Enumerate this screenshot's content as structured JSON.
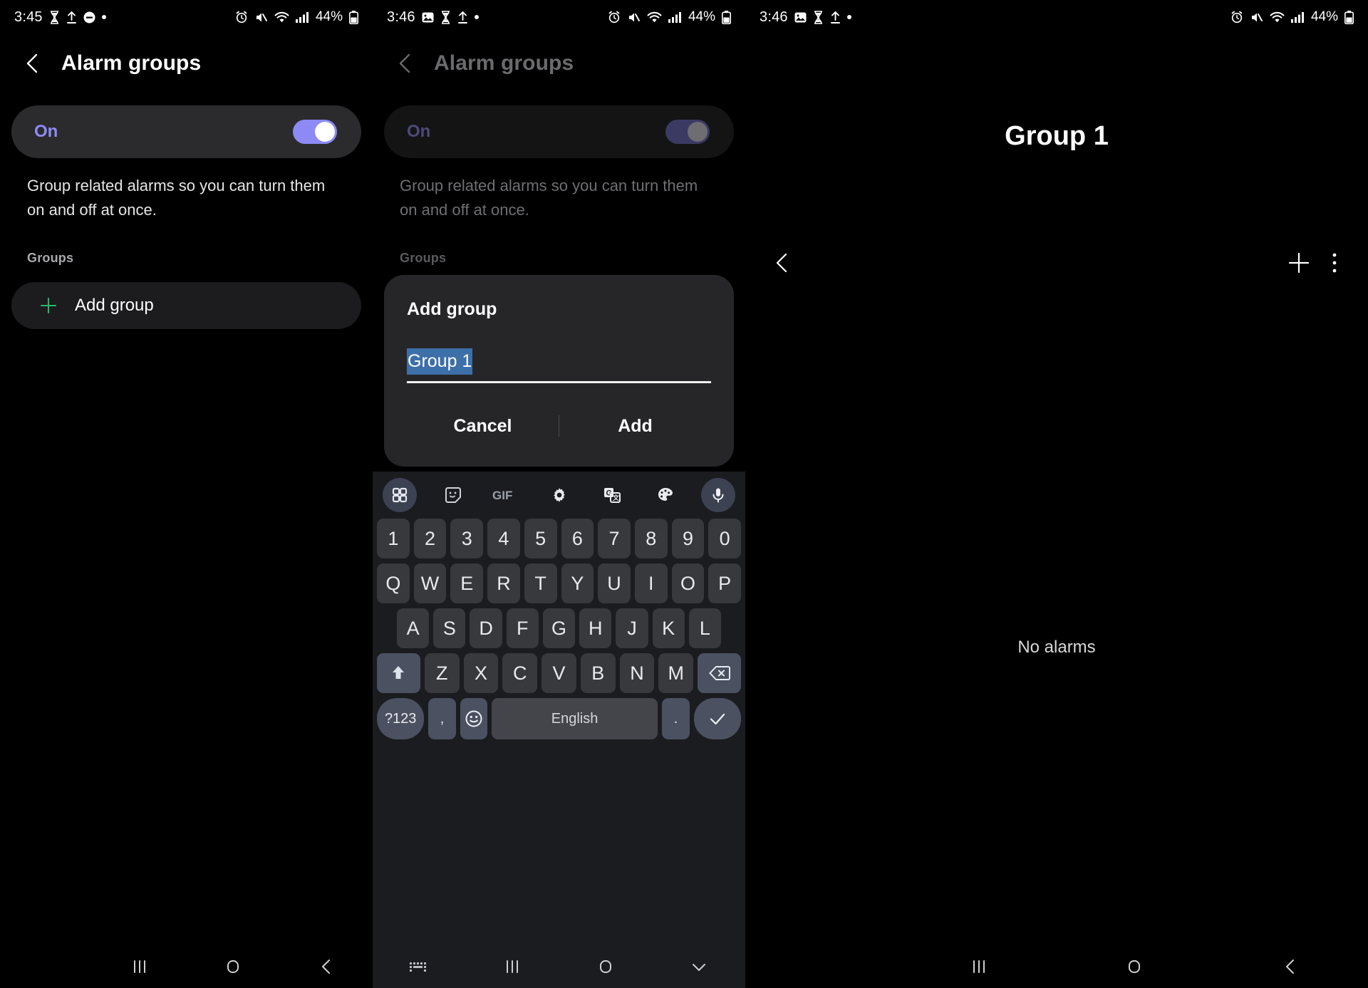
{
  "panels": [
    {
      "status": {
        "time": "3:45",
        "battery": "44%",
        "icons_left": [
          "hourglass-icon",
          "upload-icon",
          "do-not-disturb-icon",
          "dot-icon"
        ],
        "icons_right": [
          "alarm-icon",
          "mute-icon",
          "wifi-icon",
          "signal-icon",
          "battery-icon"
        ]
      },
      "header": {
        "title": "Alarm groups",
        "back_icon": "chevron-left-icon"
      },
      "toggle": {
        "label": "On",
        "state": "on",
        "color": "#8d8af5"
      },
      "description": "Group related alarms so you can turn them on and off at once.",
      "section_label": "Groups",
      "add_group": {
        "label": "Add group",
        "icon": "plus-icon",
        "icon_color": "#2fb468"
      },
      "navbar": [
        "recents-icon",
        "home-icon",
        "back-icon"
      ]
    },
    {
      "status": {
        "time": "3:46",
        "battery": "44%",
        "icons_left": [
          "image-icon",
          "hourglass-icon",
          "upload-icon",
          "dot-icon"
        ],
        "icons_right": [
          "alarm-icon",
          "mute-icon",
          "wifi-icon",
          "signal-icon",
          "battery-icon"
        ]
      },
      "header": {
        "title": "Alarm groups",
        "back_icon": "chevron-left-icon"
      },
      "toggle": {
        "label": "On",
        "state": "on"
      },
      "description": "Group related alarms so you can turn them on and off at once.",
      "section_label": "Groups",
      "dialog": {
        "title": "Add group",
        "input_value": "Group 1",
        "input_selected": true,
        "cancel_label": "Cancel",
        "confirm_label": "Add"
      },
      "keyboard": {
        "toolbar": [
          "keyboard-modes-icon",
          "sticker-icon",
          "gif-icon",
          "gear-icon",
          "translate-icon",
          "theme-palette-icon",
          "microphone-icon"
        ],
        "toolbar_labels": {
          "gif": "GIF"
        },
        "row_numbers": [
          "1",
          "2",
          "3",
          "4",
          "5",
          "6",
          "7",
          "8",
          "9",
          "0"
        ],
        "row_top": [
          "Q",
          "W",
          "E",
          "R",
          "T",
          "Y",
          "U",
          "I",
          "O",
          "P"
        ],
        "row_home": [
          "A",
          "S",
          "D",
          "F",
          "G",
          "H",
          "J",
          "K",
          "L"
        ],
        "row_bottom": [
          "Z",
          "X",
          "C",
          "V",
          "B",
          "N",
          "M"
        ],
        "shift_icon": "shift-up-icon",
        "backspace_icon": "backspace-icon",
        "symbols_label": "?123",
        "comma_label": ",",
        "emoji_icon": "emoji-icon",
        "space_label": "English",
        "period_label": ".",
        "enter_icon": "checkmark-icon"
      },
      "navbar": [
        "keyboard-hide-icon",
        "recents-icon",
        "home-icon",
        "chevron-down-icon"
      ]
    },
    {
      "status": {
        "time": "3:46",
        "battery": "44%",
        "icons_left": [
          "image-icon",
          "hourglass-icon",
          "upload-icon",
          "dot-icon"
        ],
        "icons_right": [
          "alarm-icon",
          "mute-icon",
          "wifi-icon",
          "signal-icon",
          "battery-icon"
        ]
      },
      "title": "Group 1",
      "back_icon": "chevron-left-icon",
      "actions": [
        "plus-icon",
        "overflow-menu-icon"
      ],
      "empty_state": "No alarms",
      "navbar": [
        "recents-icon",
        "home-icon",
        "back-icon"
      ]
    }
  ]
}
